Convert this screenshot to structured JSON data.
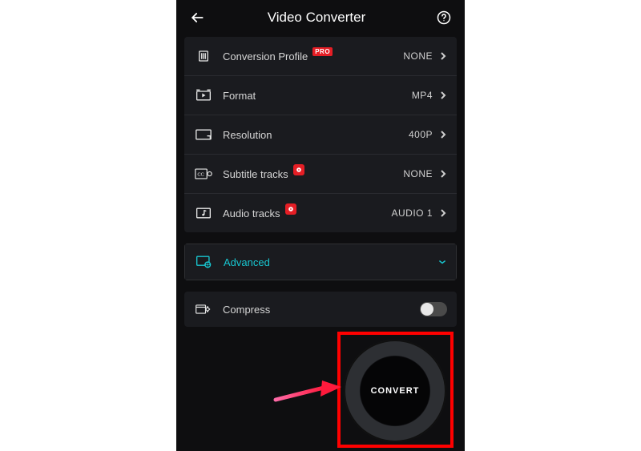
{
  "header": {
    "title": "Video Converter"
  },
  "settings": {
    "conversion_profile": {
      "label": "Conversion Profile",
      "value": "NONE",
      "badge": "PRO"
    },
    "format": {
      "label": "Format",
      "value": "MP4"
    },
    "resolution": {
      "label": "Resolution",
      "value": "400P"
    },
    "subtitle": {
      "label": "Subtitle tracks",
      "value": "NONE"
    },
    "audio": {
      "label": "Audio tracks",
      "value": "AUDIO 1"
    }
  },
  "advanced": {
    "label": "Advanced"
  },
  "compress": {
    "label": "Compress"
  },
  "convert": {
    "label": "CONVERT"
  },
  "colors": {
    "accent": "#18c6d0",
    "danger": "#e51e25"
  }
}
